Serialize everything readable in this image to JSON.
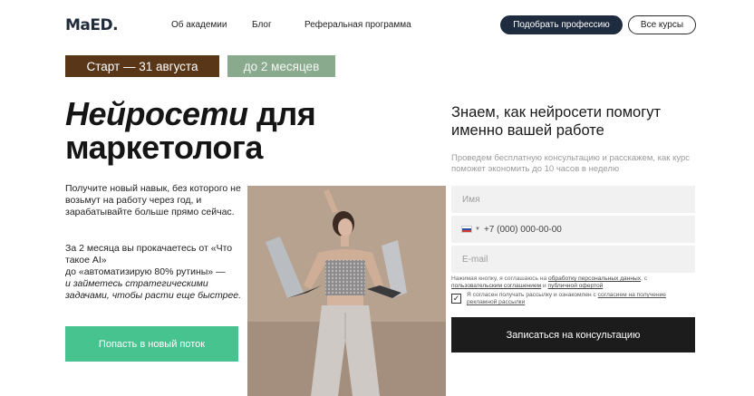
{
  "header": {
    "logo": "MaED.",
    "nav": [
      "Об академии",
      "Блог",
      "Реферальная программа"
    ],
    "pick_label": "Подобрать профессию",
    "all_label": "Все курсы"
  },
  "badges": {
    "start": "Старт —   31 августа",
    "duration": "до 2 месяцев"
  },
  "hero": {
    "title_italic": "Нейросети",
    "title_rest": " для",
    "title_line2": "маркетолога",
    "lead": "Получите новый навык, без которого не возьмут на работу через год, и зарабатывайте больше прямо сейчас.",
    "lead2_a": "За 2 месяца вы прокачаетесь от «Что такое AI»",
    "lead2_b": "до «автоматизирую 80% рутины» —",
    "lead2_c": "и займетесь стратегическими задачами, чтобы расти еще быстрее.",
    "join_label": "Попасть в новый поток"
  },
  "form": {
    "title": "Знаем, как нейросети помогут именно вашей работе",
    "subtitle": "Проведем бесплатную консультацию и расскажем, как курс поможет экономить до 10 часов в неделю",
    "name_placeholder": "Имя",
    "phone_placeholder": "+7 (000) 000-00-00",
    "email_placeholder": "E-mail",
    "legal_a": "Нажимая кнопку, я соглашаюсь на ",
    "legal_link1": "обработку персональных данных",
    "legal_b": ", с ",
    "legal_link2": "пользовательским соглашением",
    "legal_c": " и ",
    "legal_link3": "публичной офертой",
    "consent_a": "Я согласен получать рассылку и ознакомлен с ",
    "consent_link": "согласием на получение рекламной рассылки",
    "checkbox_mark": "✓",
    "submit_label": "Записаться на консультацию"
  }
}
